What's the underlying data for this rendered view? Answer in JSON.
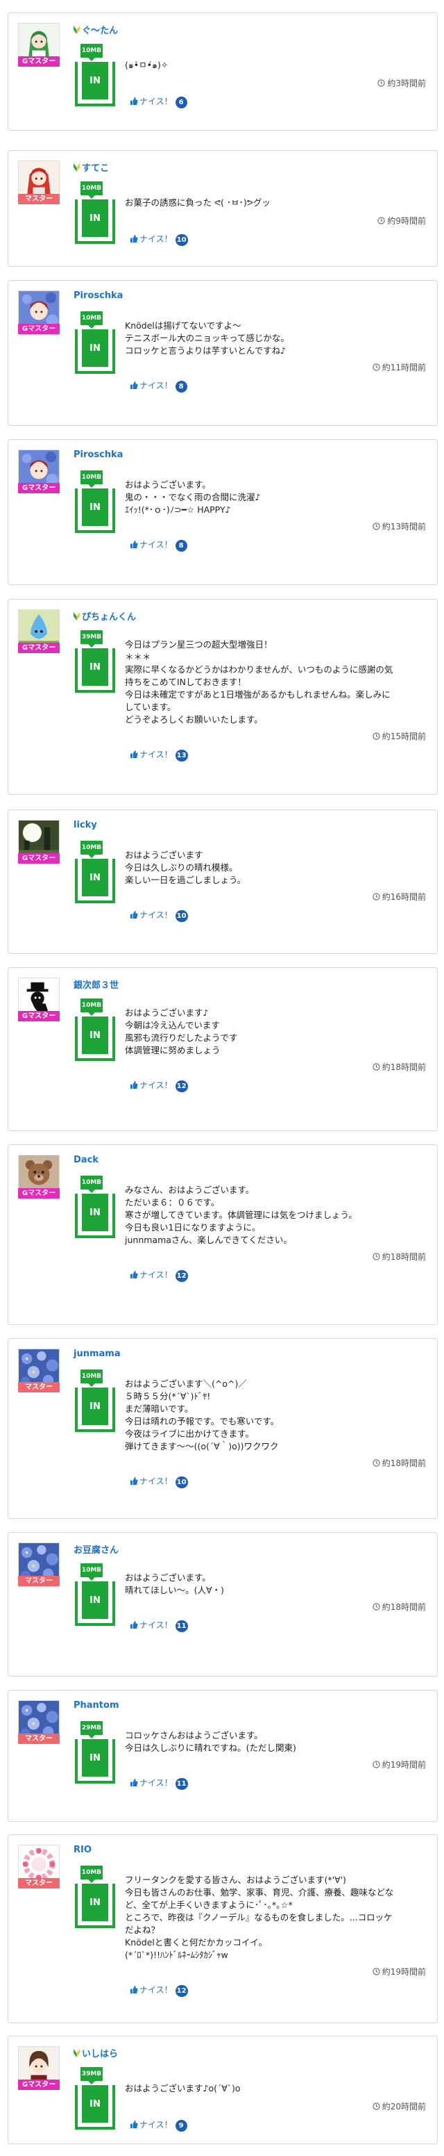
{
  "posts": [
    {
      "user": "ぐ〜たん",
      "leaf": true,
      "rank": "Gマスター",
      "rank_color": "#e32ab8",
      "mb": "10MB",
      "in_label": "IN",
      "lines": [
        "(๑•̀ㅁ•́๑)✧"
      ],
      "time": "約3時間前",
      "nice_label": "ナイス！",
      "nice_count": "6",
      "avatar": "anime-girl-green"
    },
    {
      "user": "すてこ",
      "leaf": true,
      "rank": "マスター",
      "rank_color": "#f0666d",
      "mb": "10MB",
      "in_label": "IN",
      "lines": [
        "お菓子の誘惑に負った ᕙ( ･ㅂ･)ᕗグッ"
      ],
      "time": "約9時間前",
      "nice_label": "ナイス！",
      "nice_count": "10",
      "avatar": "anime-girl-red"
    },
    {
      "user": "Piroschka",
      "leaf": false,
      "rank": "Gマスター",
      "rank_color": "#e32ab8",
      "mb": "10MB",
      "in_label": "IN",
      "lines": [
        "Knödelは揚げてないですよ〜",
        "テニスボール大のニョッキって感じかな。",
        "コロッケと言うよりは芋すいとんですね♪"
      ],
      "time": "約11時間前",
      "nice_label": "ナイス！",
      "nice_count": "8",
      "avatar": "blue-flower-girl"
    },
    {
      "user": "Piroschka",
      "leaf": false,
      "rank": "Gマスター",
      "rank_color": "#e32ab8",
      "mb": "10MB",
      "in_label": "IN",
      "lines": [
        "おはようございます。",
        "鬼の・・・でなく雨の合間に洗濯♪",
        "ｴｲｯ!(*･ｏ･)ﾉ⊃━☆ HAPPY♪"
      ],
      "time": "約13時間前",
      "nice_label": "ナイス！",
      "nice_count": "8",
      "avatar": "blue-flower-girl"
    },
    {
      "user": "ぴちょんくん",
      "leaf": true,
      "rank": "Gマスター",
      "rank_color": "#e32ab8",
      "mb": "39MB",
      "in_label": "IN",
      "lines": [
        "今日はプラン星三つの超大型増強日！",
        "＊＊＊",
        "実際に早くなるかどうかはわかりませんが、いつものように感謝の気",
        "持ちをこめてINしておきます！",
        "今日は未確定ですがあと1日増強があるかもしれませんね。楽しみに",
        "しています。",
        "どうぞよろしくお願いいたします。"
      ],
      "time": "約15時間前",
      "nice_label": "ナイス！",
      "nice_count": "13",
      "avatar": "blue-drop-character"
    },
    {
      "user": "licky",
      "leaf": false,
      "rank": "Gマスター",
      "rank_color": "#e32ab8",
      "mb": "10MB",
      "in_label": "IN",
      "lines": [
        "おはようございます",
        "今日は久しぶりの晴れ模様。",
        "楽しい一日を過ごしましょう。"
      ],
      "time": "約16時間前",
      "nice_label": "ナイス！",
      "nice_count": "10",
      "avatar": "light-forest-photo"
    },
    {
      "user": "銀次郎３世",
      "leaf": false,
      "rank": "Gマスター",
      "rank_color": "#e32ab8",
      "mb": "10MB",
      "in_label": "IN",
      "lines": [
        "おはようございます♪",
        "今朝は冷え込んでいます",
        "風邪も流行りだしたようです",
        "体調管理に努めましょう"
      ],
      "time": "約18時間前",
      "nice_label": "ナイス！",
      "nice_count": "12",
      "avatar": "black-cat-hat"
    },
    {
      "user": "Dack",
      "leaf": false,
      "rank": "Gマスター",
      "rank_color": "#e32ab8",
      "mb": "10MB",
      "in_label": "IN",
      "lines": [
        "みなさん、おはようございます。",
        "ただいま６：０６です。",
        "寒さが増してきています。体調管理には気をつけましょう。",
        "今日も良い1日になりますように。",
        "junnmamaさん、楽しんできてください。"
      ],
      "time": "約18時間前",
      "nice_label": "ナイス！",
      "nice_count": "12",
      "avatar": "teddy-bear"
    },
    {
      "user": "junmama",
      "leaf": false,
      "rank": "マスター",
      "rank_color": "#f0666d",
      "mb": "10MB",
      "in_label": "IN",
      "lines": [
        "おはようございます＼(^o^)／",
        "５時５５分(*´∀`)ﾄﾞﾔ!",
        "まだ薄暗いです。",
        "今日は晴れの予報です。でも寒いです。",
        "今夜はライブに出かけてきます。",
        "弾けてきます〜〜((o(´∀｀)o))ワクワク"
      ],
      "time": "約18時間前",
      "nice_label": "ナイス！",
      "nice_count": "10",
      "avatar": "blue-flowers"
    },
    {
      "user": "お豆腐さん",
      "leaf": false,
      "rank": "マスター",
      "rank_color": "#f0666d",
      "mb": "10MB",
      "in_label": "IN",
      "lines": [
        "おはようございます。",
        "晴れてほしい〜。(人∀・)"
      ],
      "time": "約18時間前",
      "nice_label": "ナイス！",
      "nice_count": "11",
      "avatar": "blue-flowers"
    },
    {
      "user": "Phantom",
      "leaf": false,
      "rank": "マスター",
      "rank_color": "#f0666d",
      "mb": "29MB",
      "in_label": "IN",
      "lines": [
        "コロッケさんおはようございます。",
        "今日は久しぶりに晴れですね。(ただし関東)"
      ],
      "time": "約19時間前",
      "nice_label": "ナイス！",
      "nice_count": "11",
      "avatar": "blue-flowers"
    },
    {
      "user": "RIO",
      "leaf": false,
      "rank": "マスター",
      "rank_color": "#f0666d",
      "mb": "10MB",
      "in_label": "IN",
      "lines": [
        "フリータンクを愛する皆さん、おはようございます(*'∀')",
        "今日も皆さんのお仕事、勉学、家事、育児、介護、療養、趣味などな",
        "ど、全てが上手くいきますように･ﾟ･｡*｡☆*",
        "ところで、昨夜は『クノーデル』なるものを食しました。...コロッケ",
        "だよね？",
        "Knödelと書くと何だかカッコイイ。",
        "(*´ﾛ`*)!!ﾊﾝﾄﾞﾙﾈｰﾑｼﾀｶｼﾞｬw"
      ],
      "time": "約19時間前",
      "nice_label": "ナイス！",
      "nice_count": "12",
      "avatar": "pink-floral-ring"
    },
    {
      "user": "いしはら",
      "leaf": true,
      "rank": "Gマスター",
      "rank_color": "#e32ab8",
      "mb": "39MB",
      "in_label": "IN",
      "lines": [
        "おはようございます♪o(´∀`)o"
      ],
      "time": "約20時間前",
      "nice_label": "ナイス！",
      "nice_count": "9",
      "avatar": "anime-boy-brown"
    }
  ]
}
